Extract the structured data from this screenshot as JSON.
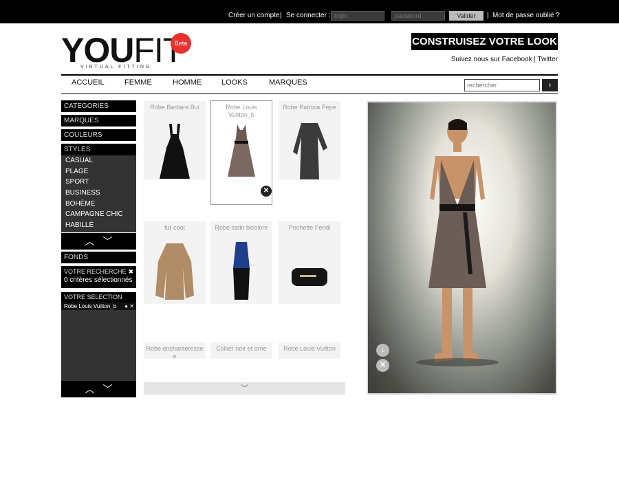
{
  "topbar": {
    "create_account": "Créer un compte",
    "separator": "|",
    "login_label": "Se connecter :",
    "login_placeholder": "login",
    "password_placeholder": "password",
    "submit": "Valider",
    "forgot_password": "Mot de passe oublié ?"
  },
  "header": {
    "logo_you": "YOU",
    "logo_fit": "FIT",
    "logo_sub": "VIRTUAL FITTING",
    "beta": "Beta",
    "build_look": "CONSTRUISEZ VOTRE LOOK",
    "follow_text": "Suivez nous sur Facebook | Twitter"
  },
  "nav": {
    "items": [
      "ACCUEIL",
      "FEMME",
      "HOMME",
      "LOOKS",
      "MARQUES"
    ],
    "search_placeholder": "rechercher",
    "search_button": "›"
  },
  "sidebar": {
    "categories": "CATEGORIES",
    "marques": "MARQUES",
    "couleurs": "COULEURS",
    "styles": "STYLES",
    "style_items": [
      "CASUAL",
      "PLAGE",
      "SPORT",
      "BUSINESS",
      "BOHÈME",
      "CAMPAGNE CHIC",
      "HABILLÉ"
    ],
    "fonds": "FONDS",
    "search_title": "VOTRE RECHERCHE",
    "search_count": "0 critères sélectionnés",
    "selection_title": "VOTRE SELECTION",
    "selection_items": [
      "Robe Louis Vuitton_b"
    ]
  },
  "products": [
    {
      "name": "Robe Barbara Bui"
    },
    {
      "name": "Robe Louis Vuitton_b"
    },
    {
      "name": "Robe Patrizia Pepe"
    },
    {
      "name": "fur coat"
    },
    {
      "name": "Robe satin bicolore"
    },
    {
      "name": "Pochette Fendi"
    },
    {
      "name": "Robe enchanteresse e"
    },
    {
      "name": "Collier noir et orne"
    },
    {
      "name": "Robe Louis Vuitton"
    }
  ],
  "colors": {
    "accent_red": "#e8322e",
    "bar_black": "#000000",
    "sidebar_gray": "#333333"
  }
}
